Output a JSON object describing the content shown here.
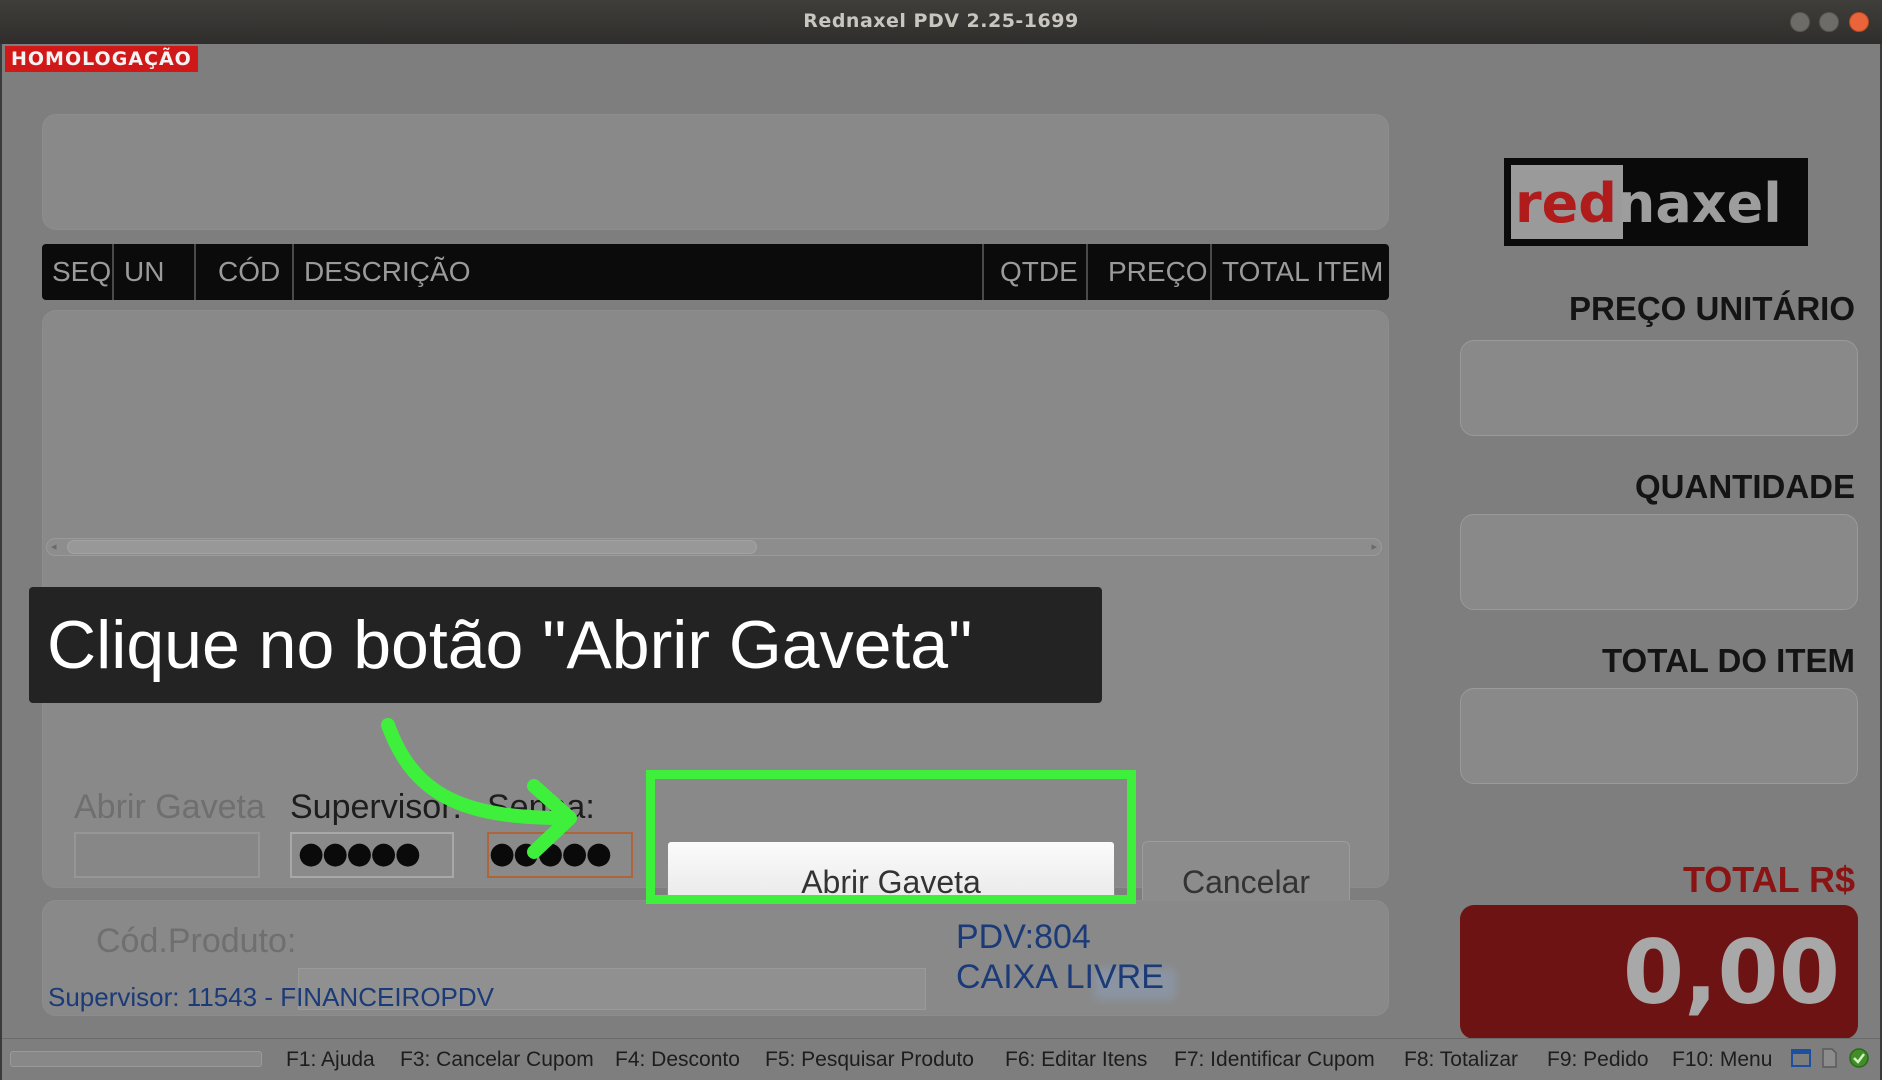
{
  "window": {
    "title": "Rednaxel PDV 2.25-1699",
    "env_badge": "HOMOLOGAÇÃO"
  },
  "table": {
    "columns": [
      "SEQ",
      "UN",
      "CÓD",
      "DESCRIÇÃO",
      "QTDE",
      "PREÇO",
      "TOTAL ITEM"
    ]
  },
  "drawer_dialog": {
    "title": "Abrir Gaveta",
    "supervisor_label": "Supervisor:",
    "supervisor_value": "●●●●●",
    "password_label": "Senha:",
    "password_value": "●●●●●",
    "open_button": "Abrir Gaveta",
    "cancel_button": "Cancelar"
  },
  "tutorial": {
    "instruction": "Clique no botão \"Abrir Gaveta\"",
    "highlight_color": "#3ef03b"
  },
  "footer": {
    "product_code_label": "Cód.Produto:",
    "supervisor_info": "Supervisor: 11543 - FINANCEIROPDV",
    "pdv_label": "PDV:804",
    "cashier_status": "CAIXA LIVRE"
  },
  "right_panel": {
    "logo_red": "red",
    "logo_rest": "naxel",
    "unit_price_label": "PREÇO UNITÁRIO",
    "quantity_label": "QUANTIDADE",
    "item_total_label": "TOTAL DO ITEM",
    "total_label": "TOTAL R$",
    "total_value": "0,00"
  },
  "status_bar": {
    "shortcuts": [
      "F1: Ajuda",
      "F3: Cancelar Cupom",
      "F4: Desconto",
      "F5: Pesquisar Produto",
      "F6: Editar Itens",
      "F7: Identificar Cupom",
      "F8: Totalizar",
      "F9: Pedido",
      "F10: Menu"
    ]
  },
  "colors": {
    "brand_red": "#b01b1b",
    "total_box": "#6e1313",
    "info_blue": "#1b3a78"
  }
}
